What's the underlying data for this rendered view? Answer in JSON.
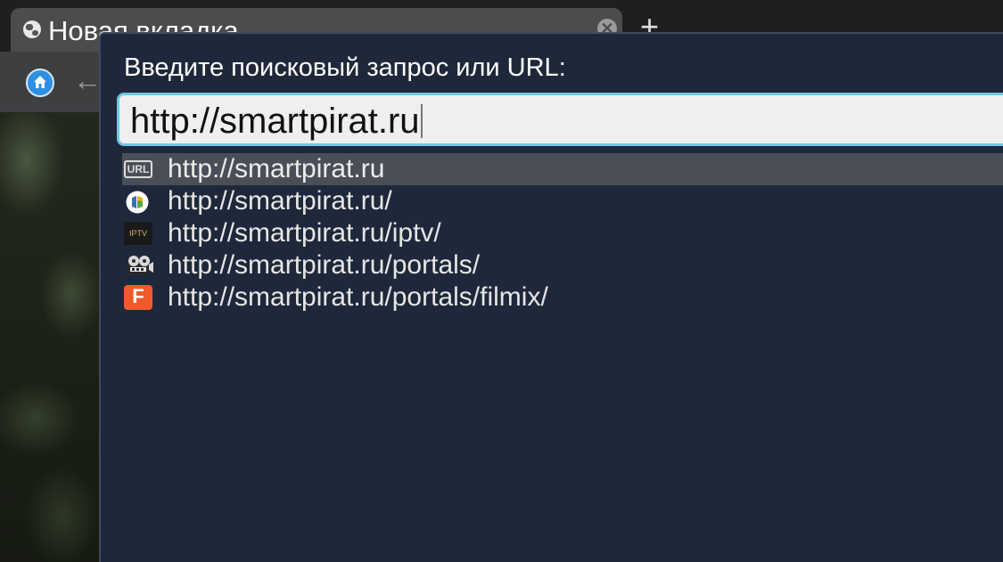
{
  "tab": {
    "title": "Новая вкладка",
    "close_symbol": "✕",
    "new_tab_symbol": "+"
  },
  "toolbar": {
    "back_symbol": "←"
  },
  "dialog": {
    "prompt": "Введите поисковый запрос или URL:",
    "input_value": "http://smartpirat.ru"
  },
  "suggestions": [
    {
      "text": "http://smartpirat.ru",
      "icon": "url-icon",
      "icon_label": "URL",
      "selected": true
    },
    {
      "text": "http://smartpirat.ru/",
      "icon": "smartpirat-logo-icon",
      "selected": false
    },
    {
      "text": "http://smartpirat.ru/iptv/",
      "icon": "iptv-icon",
      "icon_label": "IPTV",
      "selected": false
    },
    {
      "text": "http://smartpirat.ru/portals/",
      "icon": "film-reel-icon",
      "selected": false
    },
    {
      "text": "http://smartpirat.ru/portals/filmix/",
      "icon": "filmix-icon",
      "icon_label": "F",
      "selected": false
    }
  ],
  "colors": {
    "popup_bg": "#1f283a",
    "input_border": "#6fc6e8",
    "selected_row": "#4a4f57",
    "home_button": "#2f8fe3",
    "filmix": "#ef5a2d"
  }
}
